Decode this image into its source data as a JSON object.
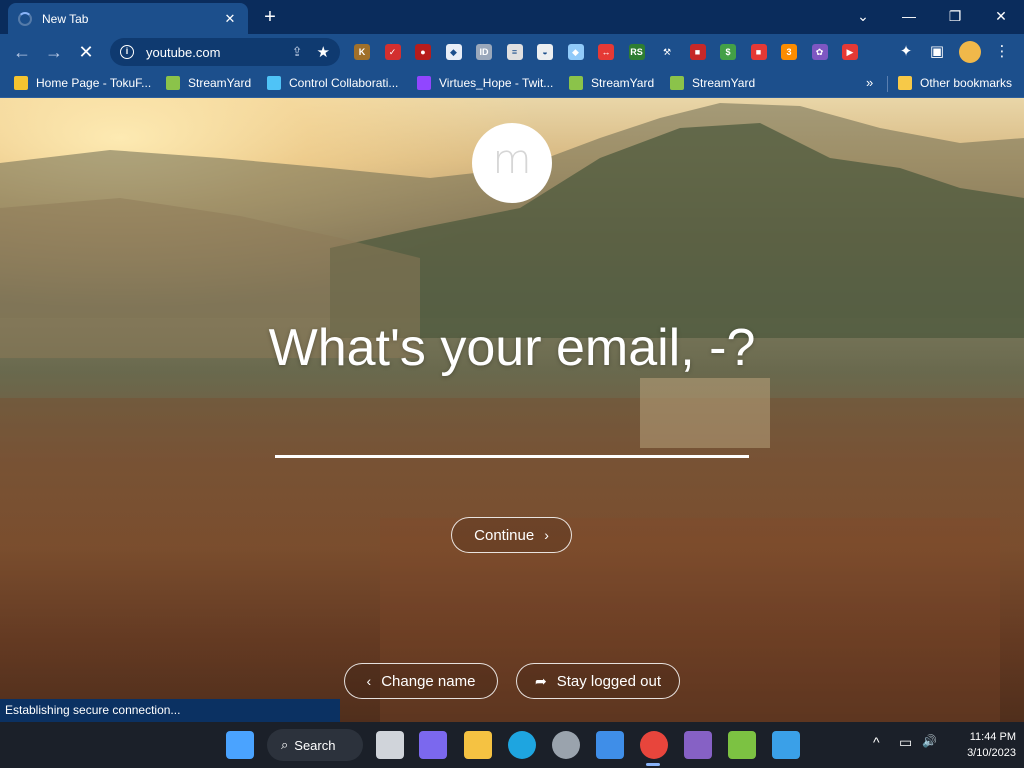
{
  "browser": {
    "tab": {
      "title": "New Tab",
      "close": "✕"
    },
    "new_tab": "+",
    "window_controls": {
      "dropdown": "⌄",
      "minimize": "—",
      "restore": "❐",
      "close": "✕"
    },
    "nav": {
      "back": "←",
      "forward": "→",
      "stop": "✕"
    },
    "omnibox": {
      "info": "i",
      "url": "youtube.com",
      "share": "⇪",
      "star": "★"
    },
    "toolbar_right": {
      "extensions": "✦",
      "side_panel": "▣",
      "menu": "⋮"
    }
  },
  "extensions": [
    {
      "name": "k-extension-icon",
      "label": "K",
      "color": "#a0702a"
    },
    {
      "name": "red-check-extension-icon",
      "label": "✓",
      "color": "#d32f2f"
    },
    {
      "name": "record-extension-icon",
      "label": "●",
      "color": "#b71c1c"
    },
    {
      "name": "white-extension-icon",
      "label": "◆",
      "color": "#e8eef7"
    },
    {
      "name": "id-extension-icon",
      "label": "ID",
      "color": "#9aa8bb"
    },
    {
      "name": "url-extension-icon",
      "label": "≡",
      "color": "#e0e0e0"
    },
    {
      "name": "spy-extension-icon",
      "label": "◒",
      "color": "#eceff1"
    },
    {
      "name": "blue-square-extension-icon",
      "label": "◆",
      "color": "#90caf9"
    },
    {
      "name": "arrows-extension-icon",
      "label": "↔",
      "color": "#e53935"
    },
    {
      "name": "rs-extension-icon",
      "label": "RS",
      "color": "#2e7d32"
    },
    {
      "name": "tool-extension-icon",
      "label": "⚒",
      "color": "#1c4f8c"
    },
    {
      "name": "red-extension-icon",
      "label": "■",
      "color": "#c62828"
    },
    {
      "name": "money-extension-icon",
      "label": "$",
      "color": "#43a047"
    },
    {
      "name": "red-box-extension-icon",
      "label": "■",
      "color": "#e53935"
    },
    {
      "name": "badge-extension-icon",
      "label": "3",
      "color": "#fb8c00"
    },
    {
      "name": "purple-extension-icon",
      "label": "✿",
      "color": "#7e57c2"
    },
    {
      "name": "youtube-extension-icon",
      "label": "▶",
      "color": "#e53935"
    }
  ],
  "bookmarks": [
    {
      "label": "Home Page - TokuF...",
      "color": "#f4c430"
    },
    {
      "label": "StreamYard",
      "color": "#8bc34a"
    },
    {
      "label": "Control Collaborati...",
      "color": "#4fc3f7"
    },
    {
      "label": "Virtues_Hope - Twit...",
      "color": "#9146ff"
    },
    {
      "label": "StreamYard",
      "color": "#8bc34a"
    },
    {
      "label": "StreamYard",
      "color": "#8bc34a"
    }
  ],
  "bookmarks_more": "»",
  "other_bookmarks": {
    "label": "Other bookmarks",
    "color": "#f7c948"
  },
  "page": {
    "logo_letter": "m",
    "question": "What's your email, -?",
    "email_value": "",
    "continue": {
      "label": "Continue",
      "icon": "›"
    },
    "change_name": {
      "label": "Change name",
      "icon": "‹"
    },
    "stay_logged_out": {
      "label": "Stay logged out",
      "icon": "➦"
    }
  },
  "status_text": "Establishing secure connection...",
  "taskbar": {
    "search_label": "Search",
    "search_icon": "⌕",
    "apps": [
      {
        "name": "start-icon",
        "color": "#4aa3ff"
      },
      {
        "name": "task-view-icon",
        "color": "#d0d4da"
      },
      {
        "name": "teams-chat-icon",
        "color": "#7b68ee"
      },
      {
        "name": "file-explorer-icon",
        "color": "#f5c242"
      },
      {
        "name": "edge-icon",
        "color": "#1ea5e0"
      },
      {
        "name": "settings-icon",
        "color": "#9aa3ad"
      },
      {
        "name": "store-icon",
        "color": "#3f8ee8"
      },
      {
        "name": "chrome-icon",
        "color": "#e8453c"
      },
      {
        "name": "visual-studio-icon",
        "color": "#8661c5"
      },
      {
        "name": "game-icon",
        "color": "#7cc242"
      },
      {
        "name": "photos-icon",
        "color": "#3aa0e8"
      }
    ],
    "tray": {
      "chevron": "^",
      "network": "▭",
      "volume": "🔊"
    },
    "time": "11:44 PM",
    "date": "3/10/2023"
  }
}
